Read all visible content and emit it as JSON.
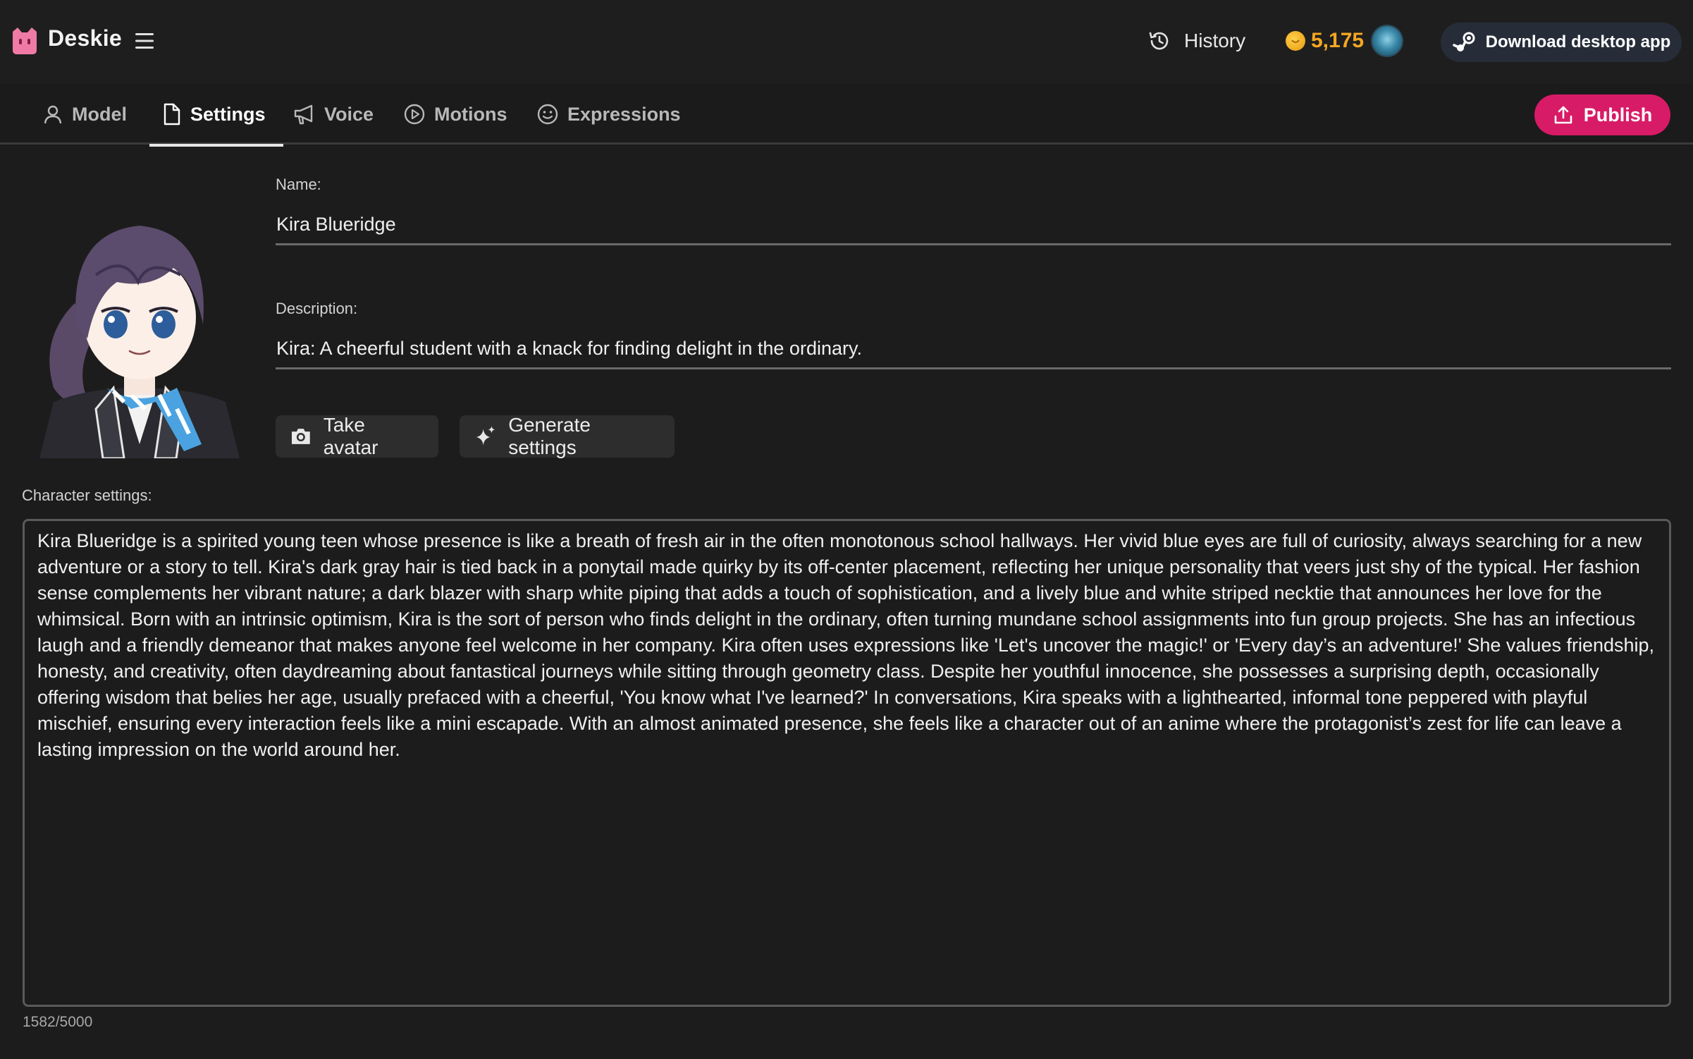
{
  "header": {
    "brand": "Deskie",
    "history_label": "History",
    "coin_count": "5,175",
    "download_label": "Download desktop app"
  },
  "tabs": [
    {
      "label": "Model",
      "icon": "user-icon",
      "active": false
    },
    {
      "label": "Settings",
      "icon": "document-icon",
      "active": true
    },
    {
      "label": "Voice",
      "icon": "megaphone-icon",
      "active": false
    },
    {
      "label": "Motions",
      "icon": "play-circle-icon",
      "active": false
    },
    {
      "label": "Expressions",
      "icon": "smile-icon",
      "active": false
    }
  ],
  "publish_label": "Publish",
  "form": {
    "name_label": "Name:",
    "name_value": "Kira Blueridge",
    "description_label": "Description:",
    "description_value": "Kira: A cheerful student with a knack for finding delight in the ordinary.",
    "take_avatar_label": "Take avatar",
    "generate_settings_label": "Generate settings",
    "character_settings_label": "Character settings:",
    "character_settings_value": "Kira Blueridge is a spirited young teen whose presence is like a breath of fresh air in the often monotonous school hallways. Her vivid blue eyes are full of curiosity, always searching for a new adventure or a story to tell. Kira's dark gray hair is tied back in a ponytail made quirky by its off-center placement, reflecting her unique personality that veers just shy of the typical. Her fashion sense complements her vibrant nature; a dark blazer with sharp white piping that adds a touch of sophistication, and a lively blue and white striped necktie that announces her love for the whimsical. Born with an intrinsic optimism, Kira is the sort of person who finds delight in the ordinary, often turning mundane school assignments into fun group projects. She has an infectious laugh and a friendly demeanor that makes anyone feel welcome in her company. Kira often uses expressions like 'Let's uncover the magic!' or 'Every day’s an adventure!' She values friendship, honesty, and creativity, often daydreaming about fantastical journeys while sitting through geometry class. Despite her youthful innocence, she possesses a surprising depth, occasionally offering wisdom that belies her age, usually prefaced with a cheerful, 'You know what I've learned?' In conversations, Kira speaks with a lighthearted, informal tone peppered with playful mischief, ensuring every interaction feels like a mini escapade. With an almost animated presence, she feels like a character out of an anime where the protagonist’s zest for life can leave a lasting impression on the world around her.",
    "char_counter": "1582/5000"
  },
  "colors": {
    "accent_publish": "#d81b66",
    "coin": "#f5a623",
    "background": "#1c1c1c"
  }
}
